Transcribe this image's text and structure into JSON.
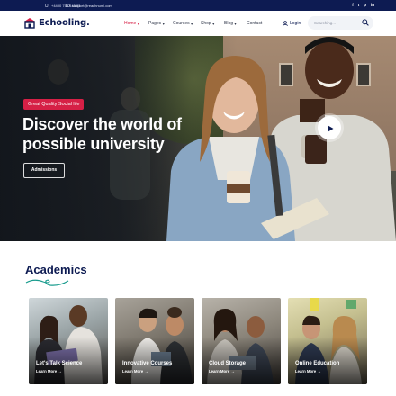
{
  "topbar": {
    "phone": "+4400 750 445 83",
    "email": "support@reachnumi.com",
    "social": [
      "f",
      "t",
      "p",
      "in"
    ]
  },
  "header": {
    "logo_text": "Echooling.",
    "nav": [
      {
        "label": "Home",
        "active": true
      },
      {
        "label": "Pages",
        "active": false
      },
      {
        "label": "Courses",
        "active": false
      },
      {
        "label": "Shop",
        "active": false
      },
      {
        "label": "Blog",
        "active": false
      },
      {
        "label": "Contact",
        "active": false
      }
    ],
    "login_label": "Login",
    "search_placeholder": "Searching..."
  },
  "hero": {
    "badge": "Great Quality Social life",
    "headline_line1": "Discover the world of",
    "headline_line2": "possible university",
    "button_label": "Admissions"
  },
  "academics": {
    "title": "Academics",
    "cards": [
      {
        "title": "Let's Talk Science",
        "link": "Learn More"
      },
      {
        "title": "Innovative Courses",
        "link": "Learn More"
      },
      {
        "title": "Cloud Storage",
        "link": "Learn More"
      },
      {
        "title": "Online Education",
        "link": "Learn More"
      }
    ]
  },
  "colors": {
    "navy": "#0d1b52",
    "accent": "#d62046"
  }
}
